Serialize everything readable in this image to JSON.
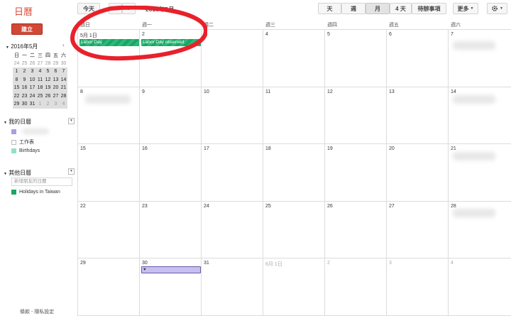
{
  "app_title": "日曆",
  "toolbar": {
    "today": "今天",
    "prev": "‹",
    "next": "›",
    "current_range": "2016年5月",
    "views": [
      "天",
      "週",
      "月",
      "4 天",
      "待辦事項"
    ],
    "selected_view": "月",
    "more": "更多",
    "settings_icon": "gear-icon"
  },
  "sidebar": {
    "create": "建立",
    "mini_cal": {
      "title": "2016年5月",
      "weekdays": [
        "日",
        "一",
        "二",
        "三",
        "四",
        "五",
        "六"
      ],
      "weeks": [
        [
          "24",
          "25",
          "26",
          "27",
          "28",
          "29",
          "30"
        ],
        [
          "1",
          "2",
          "3",
          "4",
          "5",
          "6",
          "7"
        ],
        [
          "8",
          "9",
          "10",
          "11",
          "12",
          "13",
          "14"
        ],
        [
          "15",
          "16",
          "17",
          "18",
          "19",
          "20",
          "21"
        ],
        [
          "22",
          "23",
          "24",
          "25",
          "26",
          "27",
          "28"
        ],
        [
          "29",
          "30",
          "31",
          "1",
          "2",
          "3",
          "4"
        ]
      ]
    },
    "my_calendars": {
      "title": "我的日曆",
      "items": [
        {
          "label": "",
          "color": "#a79ee6"
        },
        {
          "label": "工作表",
          "color": "#ffffff"
        },
        {
          "label": "Birthdays",
          "color": "#92e1c0"
        }
      ]
    },
    "other_calendars": {
      "title": "其他日曆",
      "add_placeholder": "新增朋友的日曆",
      "items": [
        {
          "label": "Holidays in Taiwan",
          "color": "#16a765"
        }
      ]
    },
    "footer": "條款 - 隱私設定"
  },
  "grid": {
    "weekdays": [
      "週日",
      "週一",
      "週二",
      "週三",
      "週四",
      "週五",
      "週六"
    ],
    "weeks": [
      [
        "5月 1日",
        "2",
        "3",
        "4",
        "5",
        "6",
        "7"
      ],
      [
        "8",
        "9",
        "10",
        "11",
        "12",
        "13",
        "14"
      ],
      [
        "15",
        "16",
        "17",
        "18",
        "19",
        "20",
        "21"
      ],
      [
        "22",
        "23",
        "24",
        "25",
        "26",
        "27",
        "28"
      ],
      [
        "29",
        "30",
        "31",
        "6月 1日",
        "2",
        "3",
        "4"
      ]
    ],
    "events": [
      {
        "label": "Labor Day",
        "color": "#16a765"
      },
      {
        "label": "Labor Day observed",
        "color": "#16a765"
      },
      {
        "label": "♥",
        "color": "#c7bff0"
      }
    ]
  },
  "annotation_color": "#e8212b"
}
